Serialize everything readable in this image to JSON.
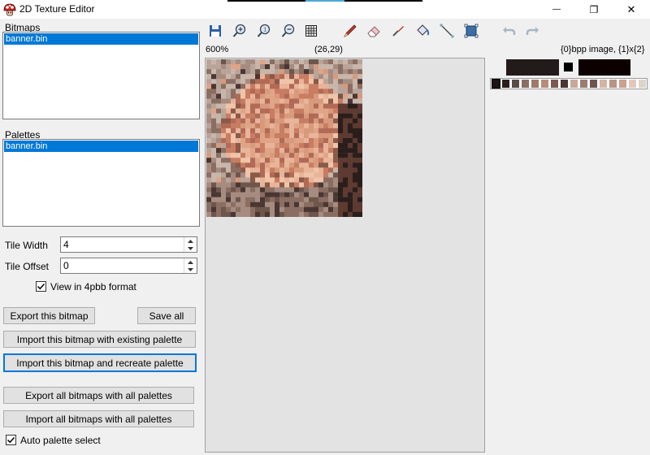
{
  "window": {
    "title": "2D Texture Editor",
    "controls": {
      "minimize": "—",
      "maximize": "❐",
      "close": "✕"
    }
  },
  "bitmaps": {
    "label": "Bitmaps",
    "items": [
      "banner.bin"
    ],
    "selected_index": 0
  },
  "palettes": {
    "label": "Palettes",
    "items": [
      "banner.bin"
    ],
    "selected_index": 0
  },
  "tile_width": {
    "label": "Tile Width",
    "value": "4"
  },
  "tile_offset": {
    "label": "Tile Offset",
    "value": "0"
  },
  "view_4pbb": {
    "label": "View in 4pbb format",
    "checked": true
  },
  "buttons": {
    "export_bitmap": "Export this bitmap",
    "save_all": "Save all",
    "import_existing": "Import this bitmap with existing palette",
    "import_recreate": "Import this bitmap and recreate palette",
    "export_all": "Export all bitmaps with all palettes",
    "import_all": "Import all bitmaps with all palettes"
  },
  "auto_palette": {
    "label": "Auto palette select",
    "checked": true
  },
  "toolbar": {
    "tools": [
      "save-icon",
      "zoom-in-icon",
      "zoom-reset-icon",
      "zoom-out-icon",
      "grid-icon",
      "pencil-icon",
      "eraser-icon",
      "eyedropper-icon",
      "fill-bucket-icon",
      "line-icon",
      "select-rect-icon",
      "undo-icon",
      "redo-icon"
    ]
  },
  "status": {
    "zoom": "600%",
    "cursor": "(26,29)",
    "image_info": "{0}bpp image, {1}x{2}"
  },
  "colors": {
    "accent": "#0078d7",
    "primary_color": "#231a1a",
    "secondary_color": "#0d0000",
    "palette": [
      "#1a1414",
      "#2a1e1c",
      "#5a4a44",
      "#8b6e62",
      "#a07a6c",
      "#b88c7c",
      "#7a5a50",
      "#4a3632",
      "#c8a89a",
      "#9a7c72",
      "#6c5650",
      "#d4b4a4",
      "#b89484",
      "#caa090",
      "#e0c8bc",
      "#dcd4cc"
    ]
  }
}
